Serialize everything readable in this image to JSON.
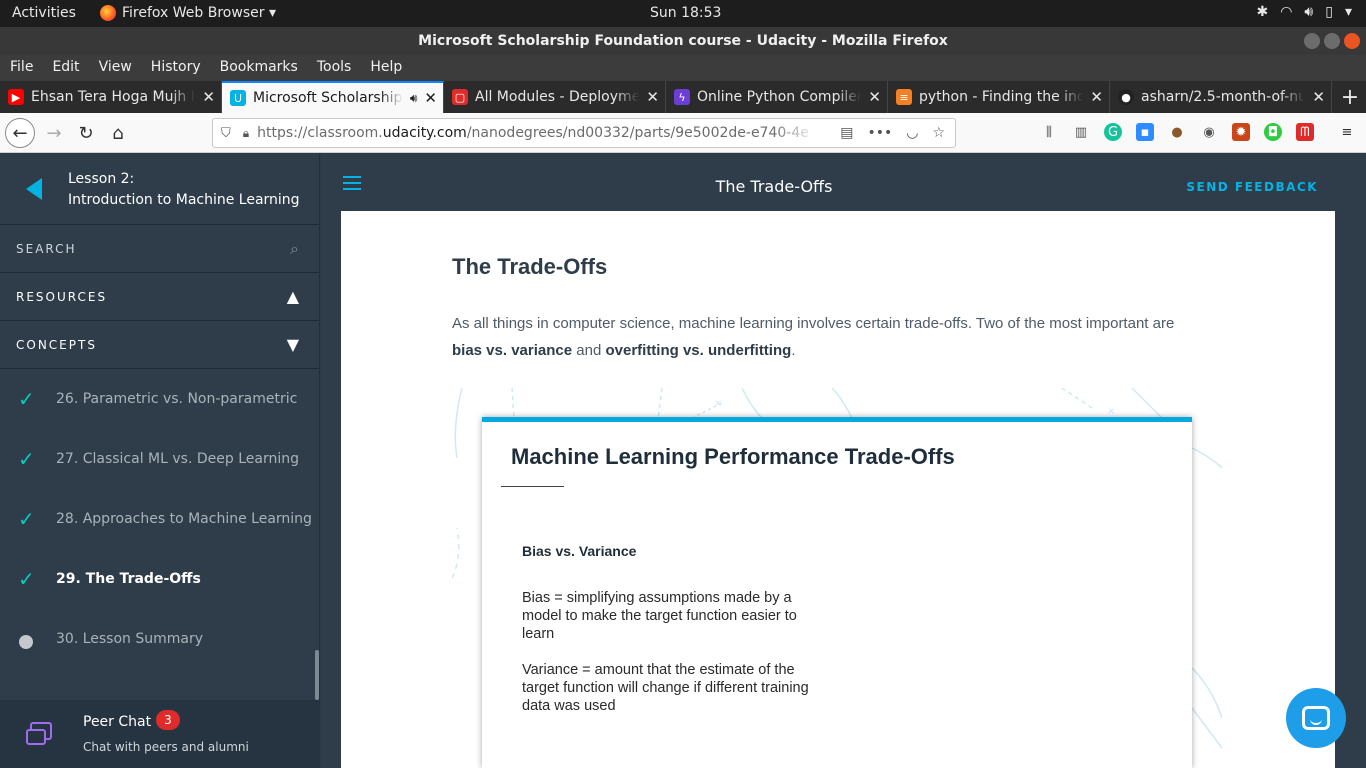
{
  "system": {
    "activities": "Activities",
    "app_name": "Firefox Web Browser ▾",
    "clock": "Sun 18:53"
  },
  "window": {
    "title": "Microsoft Scholarship Foundation course - Udacity - Mozilla Firefox"
  },
  "menu": [
    "File",
    "Edit",
    "View",
    "History",
    "Bookmarks",
    "Tools",
    "Help"
  ],
  "tabs": [
    {
      "label": "Ehsan Tera Hoga Mujh Pe",
      "icon_color": "#ff0000",
      "icon": "youtube-icon"
    },
    {
      "label": "Microsoft Scholarship",
      "icon_color": "#02b3e4",
      "icon": "udacity-icon",
      "active": true
    },
    {
      "label": "All Modules - Deployment",
      "icon_color": "#e02b2b",
      "icon": "udacity-red-icon"
    },
    {
      "label": "Online Python Compiler",
      "icon_color": "#6b3fd6",
      "icon": "bolt-icon"
    },
    {
      "label": "python - Finding the index",
      "icon_color": "#f48024",
      "icon": "stackoverflow-icon"
    },
    {
      "label": "asharn/2.5-month-of-nu",
      "icon_color": "#222222",
      "icon": "github-icon"
    }
  ],
  "url": {
    "prefix": "https://classroom.",
    "domain": "udacity.com",
    "path": "/nanodegrees/nd00332/parts/9e5002de-e740-4e"
  },
  "sidebar": {
    "lesson_label": "Lesson 2:",
    "lesson_title": "Introduction to Machine Learning",
    "search": "SEARCH",
    "resources": "RESOURCES",
    "concepts": "CONCEPTS",
    "items": [
      {
        "label": "26. Parametric vs. Non-parametric",
        "state": "done"
      },
      {
        "label": "27. Classical ML vs. Deep Learning",
        "state": "done"
      },
      {
        "label": "28. Approaches to Machine Learning",
        "state": "done"
      },
      {
        "label": "29. The Trade-Offs",
        "state": "done-active"
      },
      {
        "label": "30. Lesson Summary",
        "state": "todo"
      }
    ],
    "peer_chat": {
      "title": "Peer Chat",
      "badge": "3",
      "subtitle": "Chat with peers and alumni"
    }
  },
  "header": {
    "title": "The Trade-Offs",
    "feedback": "SEND FEEDBACK"
  },
  "content": {
    "heading": "The Trade-Offs",
    "para_a": "As all things in computer science, machine learning involves certain trade-offs. Two of the most important are ",
    "para_b1": "bias vs. variance",
    "para_and": " and ",
    "para_b2": "overfitting vs. underfitting",
    "para_end": ".",
    "slide": {
      "title": "Machine Learning Performance Trade-Offs",
      "subtitle": "Bias vs. Variance",
      "bias_def": "Bias = simplifying assumptions made by a model to make the target function easier to learn",
      "variance_def": "Variance = amount that the estimate of the target function will change if different training data was used"
    }
  },
  "colors": {
    "udacity_blue": "#02b3e4",
    "sidebar_bg": "#2e3d49",
    "check": "#02ccba",
    "badge": "#e02b2b"
  }
}
